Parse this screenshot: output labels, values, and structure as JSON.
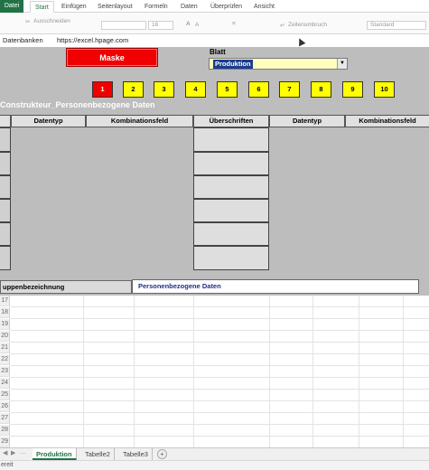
{
  "ribbon_tabs": [
    "Datei",
    "Start",
    "Einfügen",
    "Seitenlayout",
    "Formeln",
    "Daten",
    "Überprüfen",
    "Ansicht"
  ],
  "ribbon": {
    "cut": "Ausschneiden",
    "font_size": "16",
    "wrap_text": "Zeilenumbruch",
    "number_format": "Standard"
  },
  "links": {
    "datenbanken": "Datenbanken",
    "url": "https://excel.hpage.com"
  },
  "form": {
    "maske_button": "Maske",
    "blatt_label": "Blatt",
    "blatt_value": "Produktion",
    "numbers": [
      "1",
      "2",
      "3",
      "4",
      "5",
      "6",
      "7",
      "8",
      "9",
      "10"
    ],
    "selected_number": "1",
    "section_title": "Construkteur_Personenbezogene Daten",
    "headers_left": [
      "Datentyp",
      "Kombinationsfeld"
    ],
    "header_mid": "Überschriften",
    "headers_right": [
      "Datentyp",
      "Kombinationsfeld"
    ],
    "group_label": "uppenbezeichnung",
    "group_value": "Personenbezogene Daten"
  },
  "row_numbers": [
    "17",
    "18",
    "19",
    "20",
    "21",
    "22",
    "23",
    "24",
    "25",
    "26",
    "27",
    "28",
    "29"
  ],
  "sheet_tabs": [
    "Produktion",
    "Tabelle2",
    "Tabelle3"
  ],
  "active_sheet": "Produktion",
  "status_text": "ereit"
}
